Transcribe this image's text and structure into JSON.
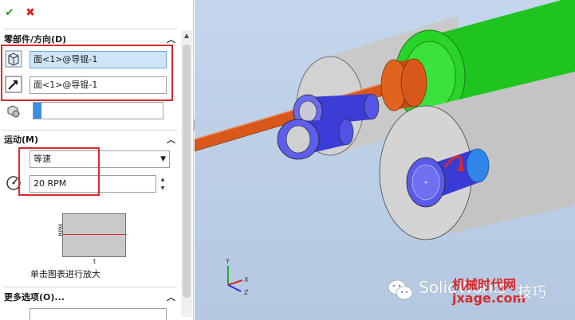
{
  "toolbar": {
    "ok_icon": "check-icon",
    "cancel_icon": "cross-icon"
  },
  "sections": {
    "components": {
      "title": "零部件/方向(D)",
      "face_selection_value": "面<1>@导锟-1",
      "direction_selection_value": "面<1>@导锟-1",
      "reference_value": ""
    },
    "motion": {
      "title": "运动(M)",
      "type_selected": "等速",
      "speed_value": "20 RPM",
      "graph_ylabel": "RPM",
      "graph_xlabel": "t",
      "graph_hint": "单击图表进行放大"
    },
    "more_options": {
      "title": "更多选项(O)..."
    }
  },
  "triad": {
    "y": "Y",
    "x": "X",
    "z": "Z"
  },
  "watermark": {
    "left_text": "SolidWorks",
    "red_top": "机械时代网",
    "red_bottom": "jxage.com",
    "right_text": "技巧"
  },
  "colors": {
    "accent_red": "#d62a2a",
    "selection_blue": "#cfe4f7",
    "ok_green": "#2e9e2e",
    "roller_green": "#2fcf2f",
    "shaft_orange": "#d8581c",
    "bearing_blue": "#4747e0",
    "roller_gray": "#cccccc"
  }
}
